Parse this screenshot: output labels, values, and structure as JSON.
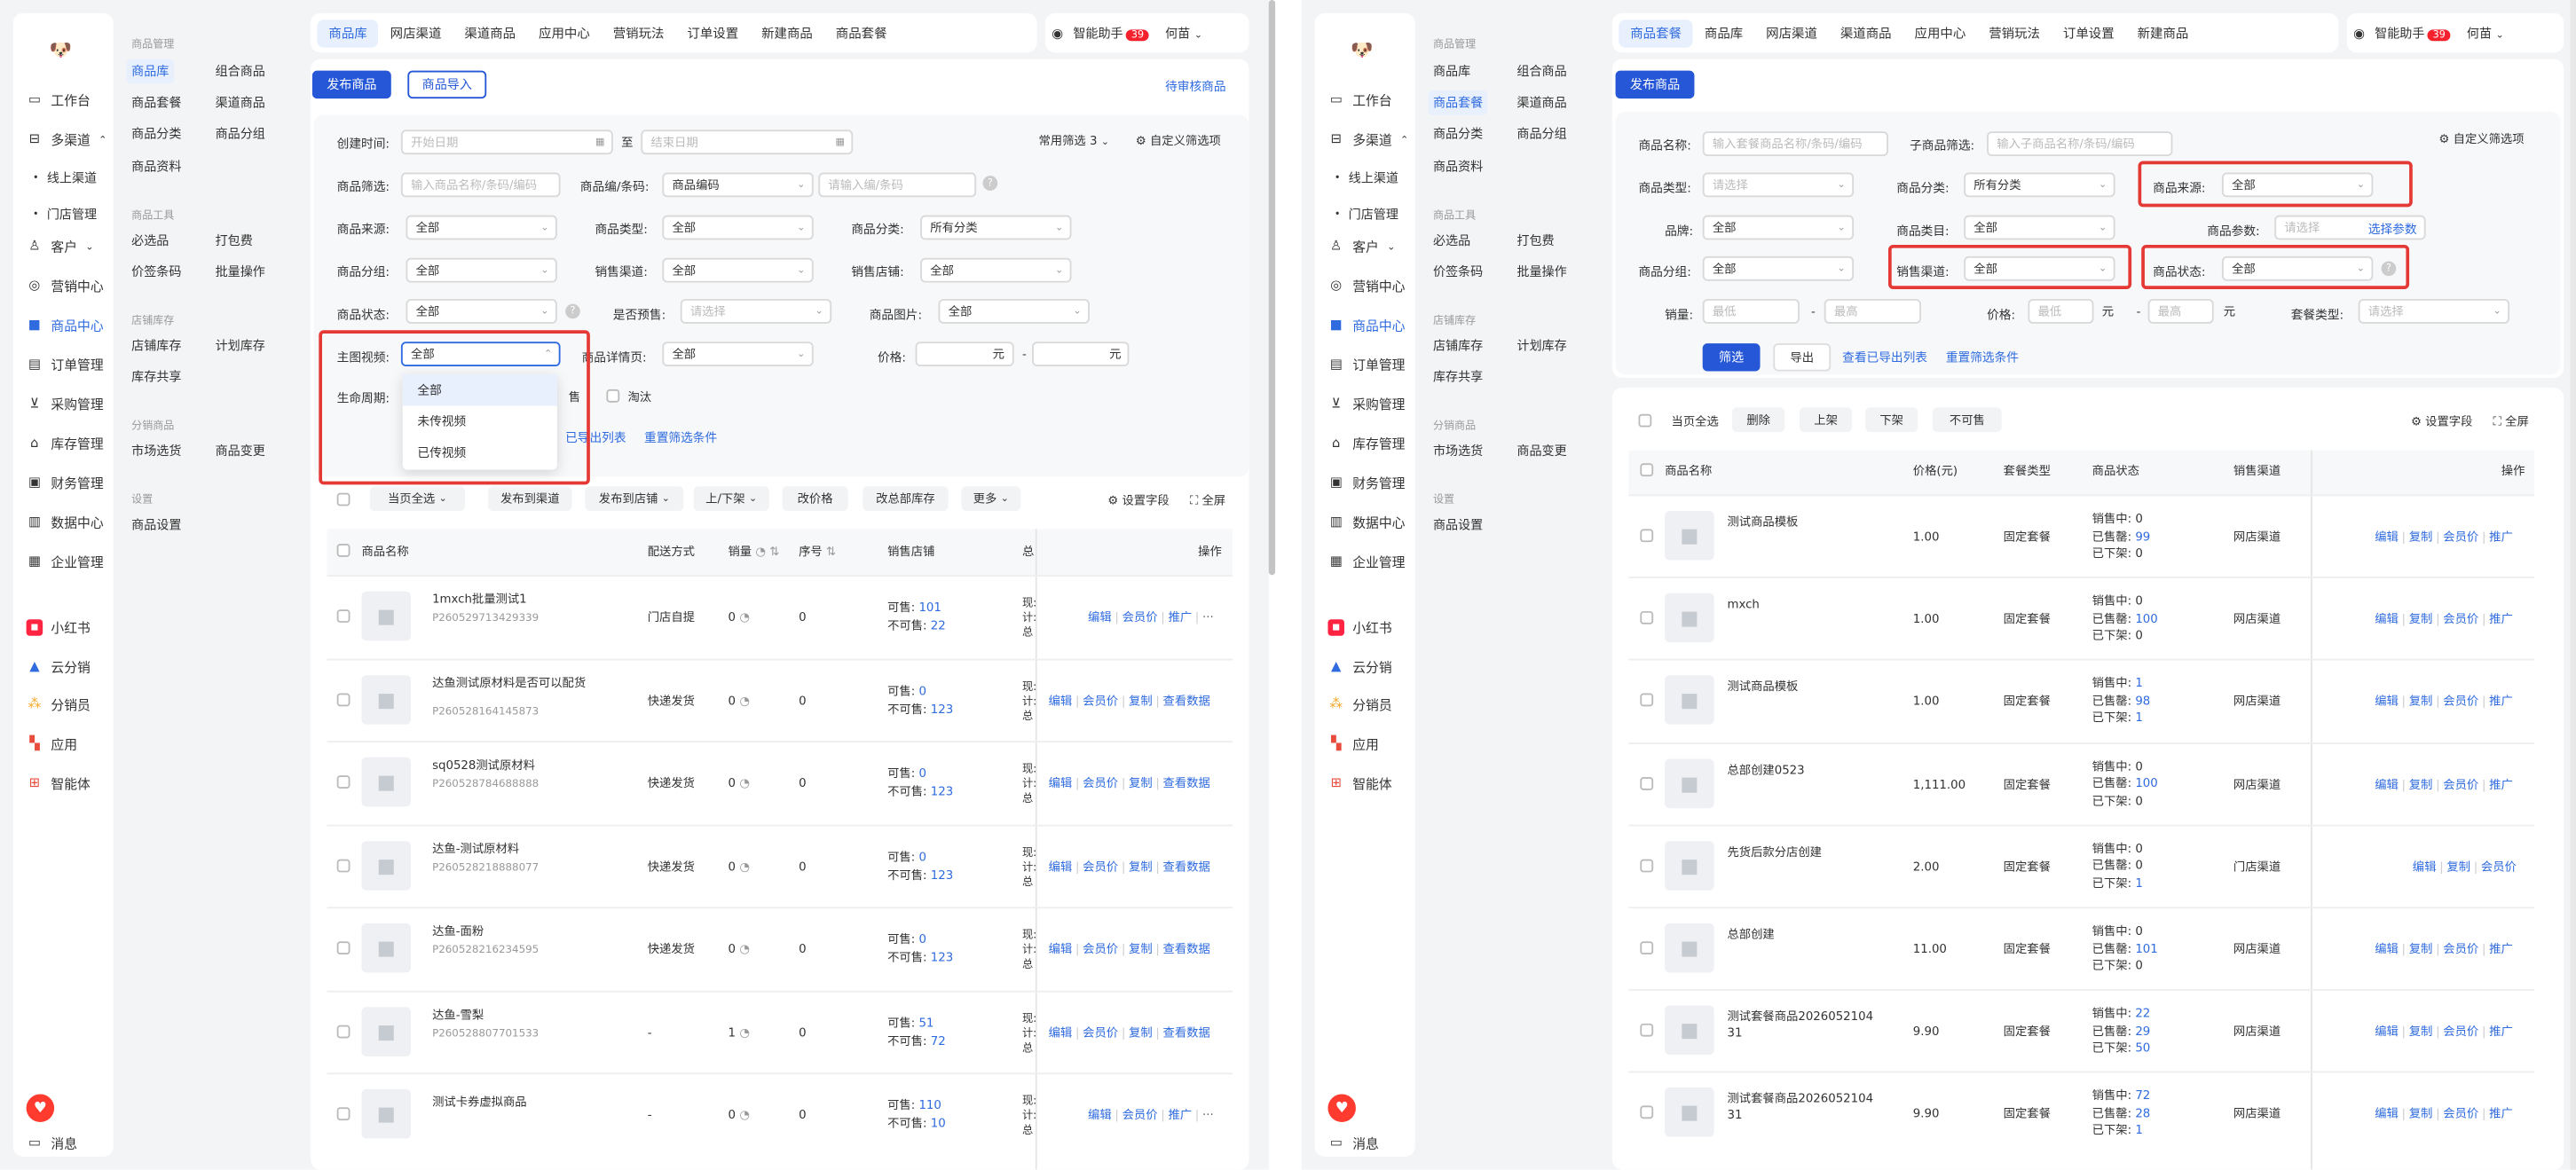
{
  "nav": {
    "logo": "🐶",
    "workbench": "工作台",
    "multi_channel": "多渠道",
    "online_channel": "线上渠道",
    "store_mgmt": "门店管理",
    "customer": "客户",
    "marketing_center": "营销中心",
    "product_center": "商品中心",
    "order_mgmt": "订单管理",
    "purchase_mgmt": "采购管理",
    "inventory_mgmt": "库存管理",
    "finance_mgmt": "财务管理",
    "data_center": "数据中心",
    "enterprise_mgmt": "企业管理",
    "xiaohongshu": "小红书",
    "cloud_dist": "云分销",
    "distributor": "分销员",
    "apps": "应用",
    "agent": "智能体",
    "message": "消息"
  },
  "subnav": {
    "grp_product_mgmt": "商品管理",
    "product_lib": "商品库",
    "combo_product": "组合商品",
    "product_package": "商品套餐",
    "channel_product": "渠道商品",
    "product_category": "商品分类",
    "product_group": "商品分组",
    "product_info": "商品资料",
    "grp_tools": "商品工具",
    "must_pick": "必选品",
    "packaging_fee": "打包费",
    "price_tag": "价签条码",
    "batch_op": "批量操作",
    "grp_store_stock": "店铺库存",
    "store_stock": "店铺库存",
    "plan_stock": "计划库存",
    "stock_share": "库存共享",
    "grp_dist": "分销商品",
    "market_pick": "市场选货",
    "product_change": "商品变更",
    "grp_settings": "设置",
    "product_settings": "商品设置"
  },
  "left": {
    "tabs": [
      "商品库",
      "网店渠道",
      "渠道商品",
      "应用中心",
      "营销玩法",
      "订单设置",
      "新建商品",
      "商品套餐"
    ],
    "assistant": "智能助手",
    "assistant_badge": "39",
    "user": "何苗",
    "btn_publish": "发布商品",
    "btn_import": "商品导入",
    "pending_review": "待审核商品",
    "f_create_time": "创建时间:",
    "f_start_date": "开始日期",
    "f_to": "至",
    "f_end_date": "结束日期",
    "f_common": "常用筛选 3",
    "f_custom": "自定义筛选项",
    "f_product_filter": "商品筛选:",
    "f_product_filter_ph": "输入商品名称/条码/编码",
    "f_code_label": "商品编/条码:",
    "f_code_val": "商品编码",
    "f_code_ph": "请输入编/条码",
    "f_source": "商品来源:",
    "f_all": "全部",
    "f_type": "商品类型:",
    "f_category": "商品分类:",
    "f_all_cat": "所有分类",
    "f_group": "商品分组:",
    "f_sale_channel": "销售渠道:",
    "f_sale_store": "销售店铺:",
    "f_status": "商品状态:",
    "f_presale": "是否预售:",
    "f_please_select": "请选择",
    "f_image": "商品图片:",
    "f_video": "主图视频:",
    "f_detail": "商品详情页:",
    "f_price": "价格:",
    "f_yuan": "元",
    "f_dash": "-",
    "f_lifecycle": "生命周期:",
    "f_on_sale": "售",
    "f_eliminate": "淘汰",
    "f_export_list": "已导出列表",
    "f_reset": "重置筛选条件",
    "dropdown": [
      "全部",
      "未传视频",
      "已传视频"
    ],
    "bar_select_page": "当页全选",
    "bar_publish_channel": "发布到渠道",
    "bar_publish_store": "发布到店铺",
    "bar_shelf": "上/下架",
    "bar_change_price": "改价格",
    "bar_change_stock": "改总部库存",
    "bar_more": "更多",
    "bar_set_fields": "设置字段",
    "bar_fullscreen": "全屏",
    "col_name": "商品名称",
    "col_delivery": "配送方式",
    "col_sales": "销量",
    "col_seq": "序号",
    "col_store": "销售店铺",
    "col_total": "总",
    "col_ops": "操作",
    "rows": [
      {
        "name": "1mxch批量测试1",
        "code": "P260529713429339",
        "delivery": "门店自提",
        "sales": "0",
        "seq": "0",
        "avail": "101",
        "unavail": "22",
        "ops": [
          "编辑",
          "会员价",
          "推广",
          "···"
        ],
        "extra": [
          "现:",
          "计:",
          "总"
        ]
      },
      {
        "name": "达鱼测试原材料是否可以配货",
        "code": "P260528164145873",
        "delivery": "快递发货",
        "sales": "0",
        "seq": "0",
        "avail": "0",
        "unavail": "123",
        "ops": [
          "编辑",
          "会员价",
          "复制",
          "查看数据"
        ],
        "extra": [
          "现:",
          "计:",
          "总"
        ]
      },
      {
        "name": "sq0528测试原材料",
        "code": "P260528784688888",
        "delivery": "快递发货",
        "sales": "0",
        "seq": "0",
        "avail": "0",
        "unavail": "123",
        "ops": [
          "编辑",
          "会员价",
          "复制",
          "查看数据"
        ],
        "extra": [
          "现:",
          "计:",
          "总"
        ]
      },
      {
        "name": "达鱼-测试原材料",
        "code": "P260528218888077",
        "delivery": "快递发货",
        "sales": "0",
        "seq": "0",
        "avail": "0",
        "unavail": "123",
        "ops": [
          "编辑",
          "会员价",
          "复制",
          "查看数据"
        ],
        "extra": [
          "现:",
          "计:",
          "总"
        ]
      },
      {
        "name": "达鱼-面粉",
        "code": "P260528216234595",
        "delivery": "快递发货",
        "sales": "0",
        "seq": "0",
        "avail": "0",
        "unavail": "123",
        "ops": [
          "编辑",
          "会员价",
          "复制",
          "查看数据"
        ],
        "extra": [
          "现:",
          "计:",
          "总"
        ]
      },
      {
        "name": "达鱼-雪梨",
        "code": "P260528807701533",
        "delivery": "-",
        "sales": "1",
        "seq": "0",
        "avail": "51",
        "unavail": "72",
        "ops": [
          "编辑",
          "会员价",
          "复制",
          "查看数据"
        ],
        "extra": [
          "现:",
          "计:",
          "总"
        ]
      },
      {
        "name": "测试卡券虚拟商品",
        "code": "",
        "delivery": "-",
        "sales": "0",
        "seq": "0",
        "avail": "110",
        "unavail": "10",
        "ops": [
          "编辑",
          "会员价",
          "推广",
          "···"
        ],
        "extra": [
          "现:",
          "计:",
          "总"
        ]
      }
    ],
    "lbl_avail": "可售:",
    "lbl_unavail": "不可售:"
  },
  "right": {
    "tabs": [
      "商品套餐",
      "商品库",
      "网店渠道",
      "渠道商品",
      "应用中心",
      "营销玩法",
      "订单设置",
      "新建商品"
    ],
    "btn_publish": "发布商品",
    "f_name": "商品名称:",
    "f_name_ph": "输入套餐商品名称/条码/编码",
    "f_child": "子商品筛选:",
    "f_child_ph": "输入子商品名称/条码/编码",
    "f_custom": "自定义筛选项",
    "f_type": "商品类型:",
    "f_please_select": "请选择",
    "f_category": "商品分类:",
    "f_all_cat": "所有分类",
    "f_source": "商品来源:",
    "f_all": "全部",
    "f_brand": "品牌:",
    "f_cat2": "商品类目:",
    "f_params": "商品参数:",
    "f_params_btn": "选择参数",
    "f_group": "商品分组:",
    "f_channel": "销售渠道:",
    "f_status": "商品状态:",
    "f_sales": "销量:",
    "f_min": "最低",
    "f_max": "最高",
    "f_price": "价格:",
    "f_yuan": "元",
    "f_pkg_type": "套餐类型:",
    "btn_filter": "筛选",
    "btn_export": "导出",
    "f_export_list": "查看已导出列表",
    "f_reset": "重置筛选条件",
    "bar_select_page": "当页全选",
    "bar_delete": "删除",
    "bar_on": "上架",
    "bar_off": "下架",
    "bar_unsell": "不可售",
    "bar_set_fields": "设置字段",
    "bar_fullscreen": "全屏",
    "col_name": "商品名称",
    "col_price": "价格(元)",
    "col_pkg": "套餐类型",
    "col_status": "商品状态",
    "col_channel": "销售渠道",
    "col_ops": "操作",
    "lbl_selling": "销售中:",
    "lbl_soldout": "已售罄:",
    "lbl_offshelf": "已下架:",
    "rows": [
      {
        "name": "测试商品模板",
        "price": "1.00",
        "pkg": "固定套餐",
        "s1": "0",
        "s2": "99",
        "s3": "0",
        "channel": "网店渠道",
        "ops": [
          "编辑",
          "复制",
          "会员价",
          "推广"
        ]
      },
      {
        "name": "mxch",
        "price": "1.00",
        "pkg": "固定套餐",
        "s1": "0",
        "s2": "100",
        "s3": "0",
        "channel": "网店渠道",
        "ops": [
          "编辑",
          "复制",
          "会员价",
          "推广"
        ]
      },
      {
        "name": "测试商品模板",
        "price": "1.00",
        "pkg": "固定套餐",
        "s1": "1",
        "s2": "98",
        "s3": "1",
        "channel": "网店渠道",
        "ops": [
          "编辑",
          "复制",
          "会员价",
          "推广"
        ]
      },
      {
        "name": "总部创建0523",
        "price": "1,111.00",
        "pkg": "固定套餐",
        "s1": "0",
        "s2": "100",
        "s3": "0",
        "channel": "网店渠道",
        "ops": [
          "编辑",
          "复制",
          "会员价",
          "推广"
        ]
      },
      {
        "name": "先货后款分店创建",
        "price": "2.00",
        "pkg": "固定套餐",
        "s1": "0",
        "s2": "0",
        "s3": "1",
        "channel": "门店渠道",
        "ops": [
          "编辑",
          "复制",
          "会员价"
        ]
      },
      {
        "name": "总部创建",
        "price": "11.00",
        "pkg": "固定套餐",
        "s1": "0",
        "s2": "101",
        "s3": "0",
        "channel": "网店渠道",
        "ops": [
          "编辑",
          "复制",
          "会员价",
          "推广"
        ]
      },
      {
        "name": "测试套餐商品2026052104\n31",
        "price": "9.90",
        "pkg": "固定套餐",
        "s1": "22",
        "s2": "29",
        "s3": "50",
        "channel": "网店渠道",
        "ops": [
          "编辑",
          "复制",
          "会员价",
          "推广"
        ]
      },
      {
        "name": "测试套餐商品2026052104\n31",
        "price": "9.90",
        "pkg": "固定套餐",
        "s1": "72",
        "s2": "28",
        "s3": "1",
        "channel": "网店渠道",
        "ops": [
          "编辑",
          "复制",
          "会员价",
          "推广"
        ]
      }
    ]
  },
  "colors": {
    "primary": "#2557d6",
    "link": "#2f6bdf",
    "highlight": "#e53935",
    "page_bg": "#f3f4f6"
  }
}
